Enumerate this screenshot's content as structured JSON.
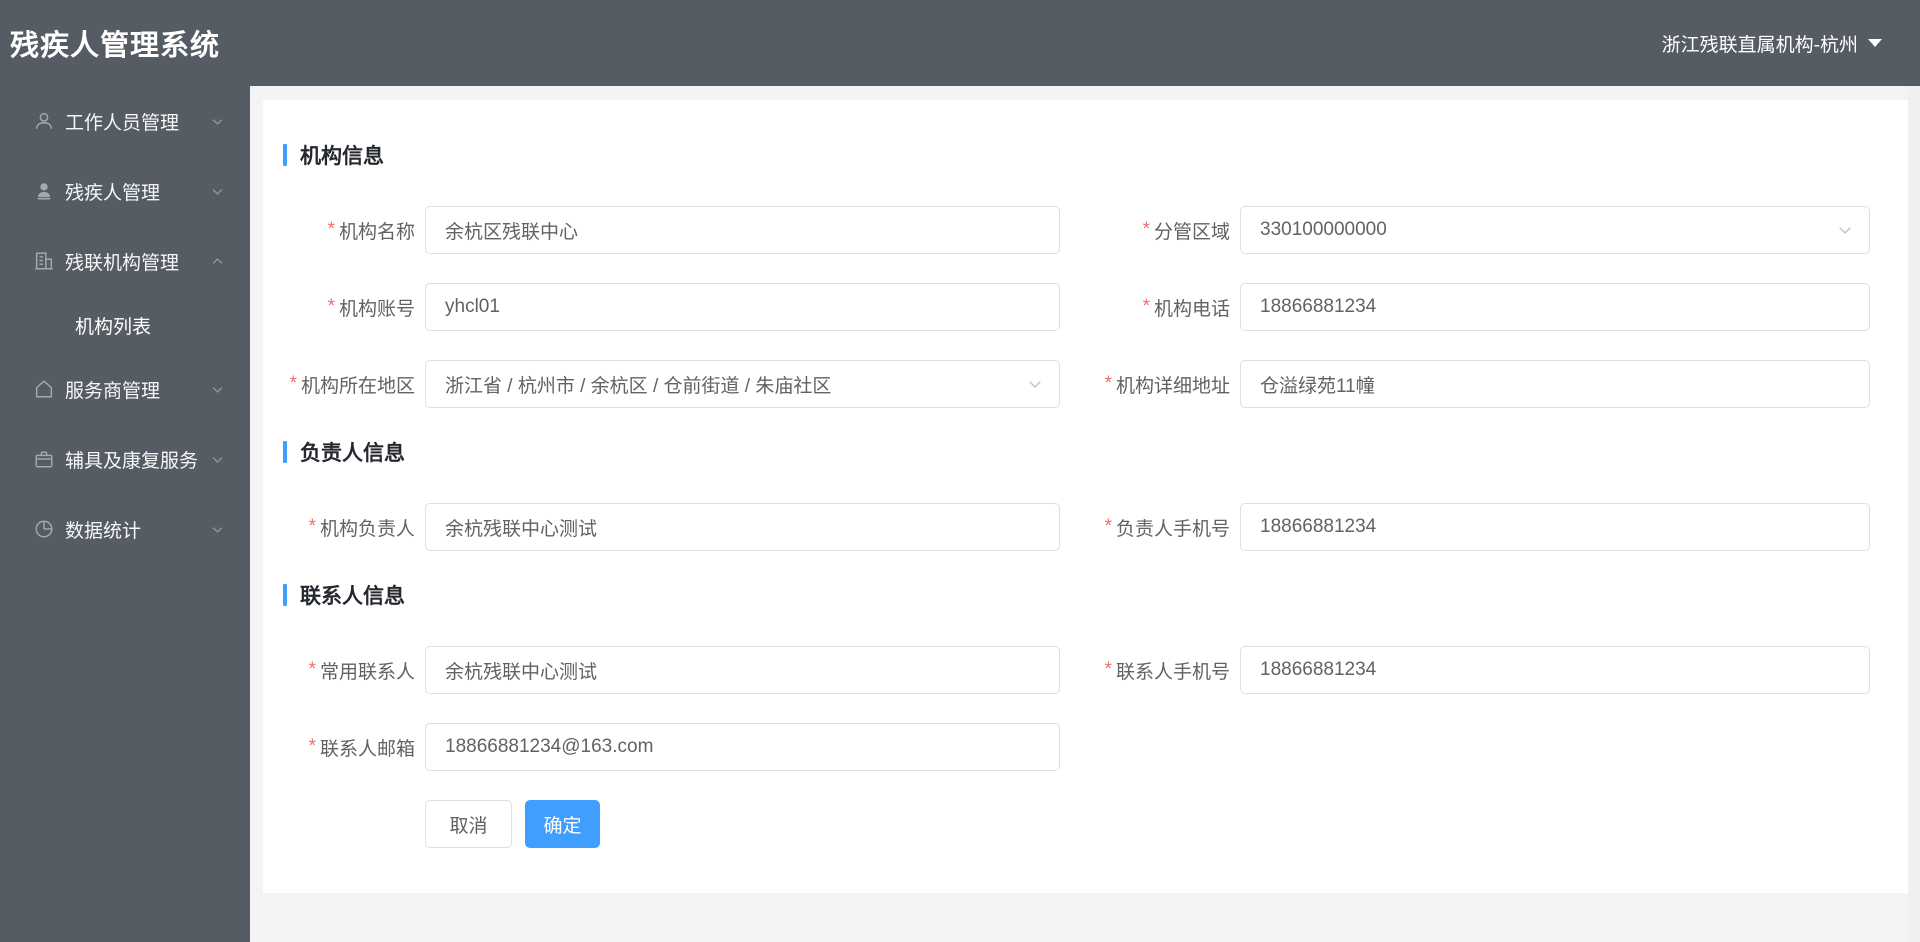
{
  "app": {
    "title": "残疾人管理系统",
    "current_org": "浙江残联直属机构-杭州"
  },
  "colors": {
    "header_bg": "#555c64",
    "accent_blue": "#409eff",
    "required_red": "#f56c6c"
  },
  "sidebar": {
    "items": [
      {
        "label": "工作人员管理",
        "icon": "user-outline-icon",
        "expanded": false
      },
      {
        "label": "残疾人管理",
        "icon": "user-filled-icon",
        "expanded": false
      },
      {
        "label": "残联机构管理",
        "icon": "building-icon",
        "expanded": true,
        "children": [
          {
            "label": "机构列表",
            "active": true
          }
        ]
      },
      {
        "label": "服务商管理",
        "icon": "home-icon",
        "expanded": false
      },
      {
        "label": "辅具及康复服务",
        "icon": "suitcase-icon",
        "expanded": false
      },
      {
        "label": "数据统计",
        "icon": "pie-chart-icon",
        "expanded": false
      }
    ]
  },
  "form": {
    "required_mark": "*",
    "sections": [
      {
        "title": "机构信息",
        "fields": [
          {
            "label": "机构名称",
            "value": "余杭区残联中心",
            "type": "text"
          },
          {
            "label": "分管区域",
            "value": "330100000000",
            "type": "select"
          },
          {
            "label": "机构账号",
            "value": "yhcl01",
            "type": "text"
          },
          {
            "label": "机构电话",
            "value": "18866881234",
            "type": "text"
          },
          {
            "label": "机构所在地区",
            "value": "浙江省 / 杭州市 / 余杭区 / 仓前街道 / 朱庙社区",
            "type": "select"
          },
          {
            "label": "机构详细地址",
            "value": "仓溢绿苑11幢",
            "type": "text"
          }
        ]
      },
      {
        "title": "负责人信息",
        "fields": [
          {
            "label": "机构负责人",
            "value": "余杭残联中心测试",
            "type": "text"
          },
          {
            "label": "负责人手机号",
            "value": "18866881234",
            "type": "text"
          }
        ]
      },
      {
        "title": "联系人信息",
        "fields": [
          {
            "label": "常用联系人",
            "value": "余杭残联中心测试",
            "type": "text"
          },
          {
            "label": "联系人手机号",
            "value": "18866881234",
            "type": "text"
          },
          {
            "label": "联系人邮箱",
            "value": "18866881234@163.com",
            "type": "text"
          }
        ]
      }
    ],
    "buttons": {
      "cancel": "取消",
      "confirm": "确定"
    }
  }
}
